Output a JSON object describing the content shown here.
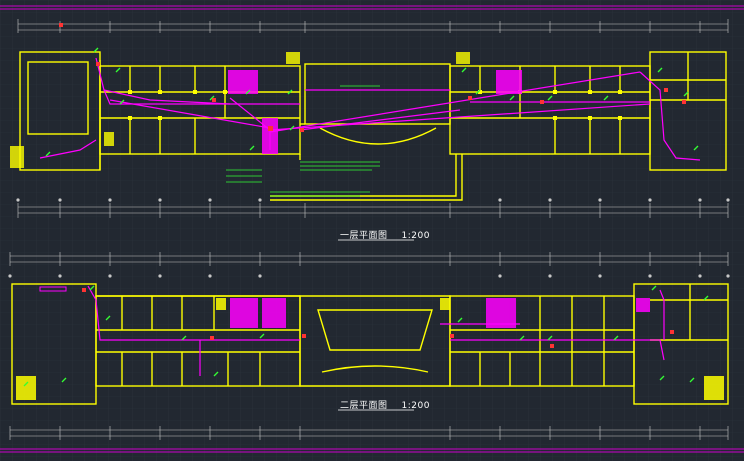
{
  "drawing": {
    "colors": {
      "background": "#222831",
      "wall": "#ffff00",
      "wiring": "#ff00ff",
      "fixture": "#33ff33",
      "dimension": "#c8c8c8",
      "marker": "#ff3333",
      "frame": "#cc00cc"
    },
    "plans": [
      {
        "title": "一层平面图",
        "scale": "1:200"
      },
      {
        "title": "二层平面图",
        "scale": "1:200"
      }
    ]
  }
}
